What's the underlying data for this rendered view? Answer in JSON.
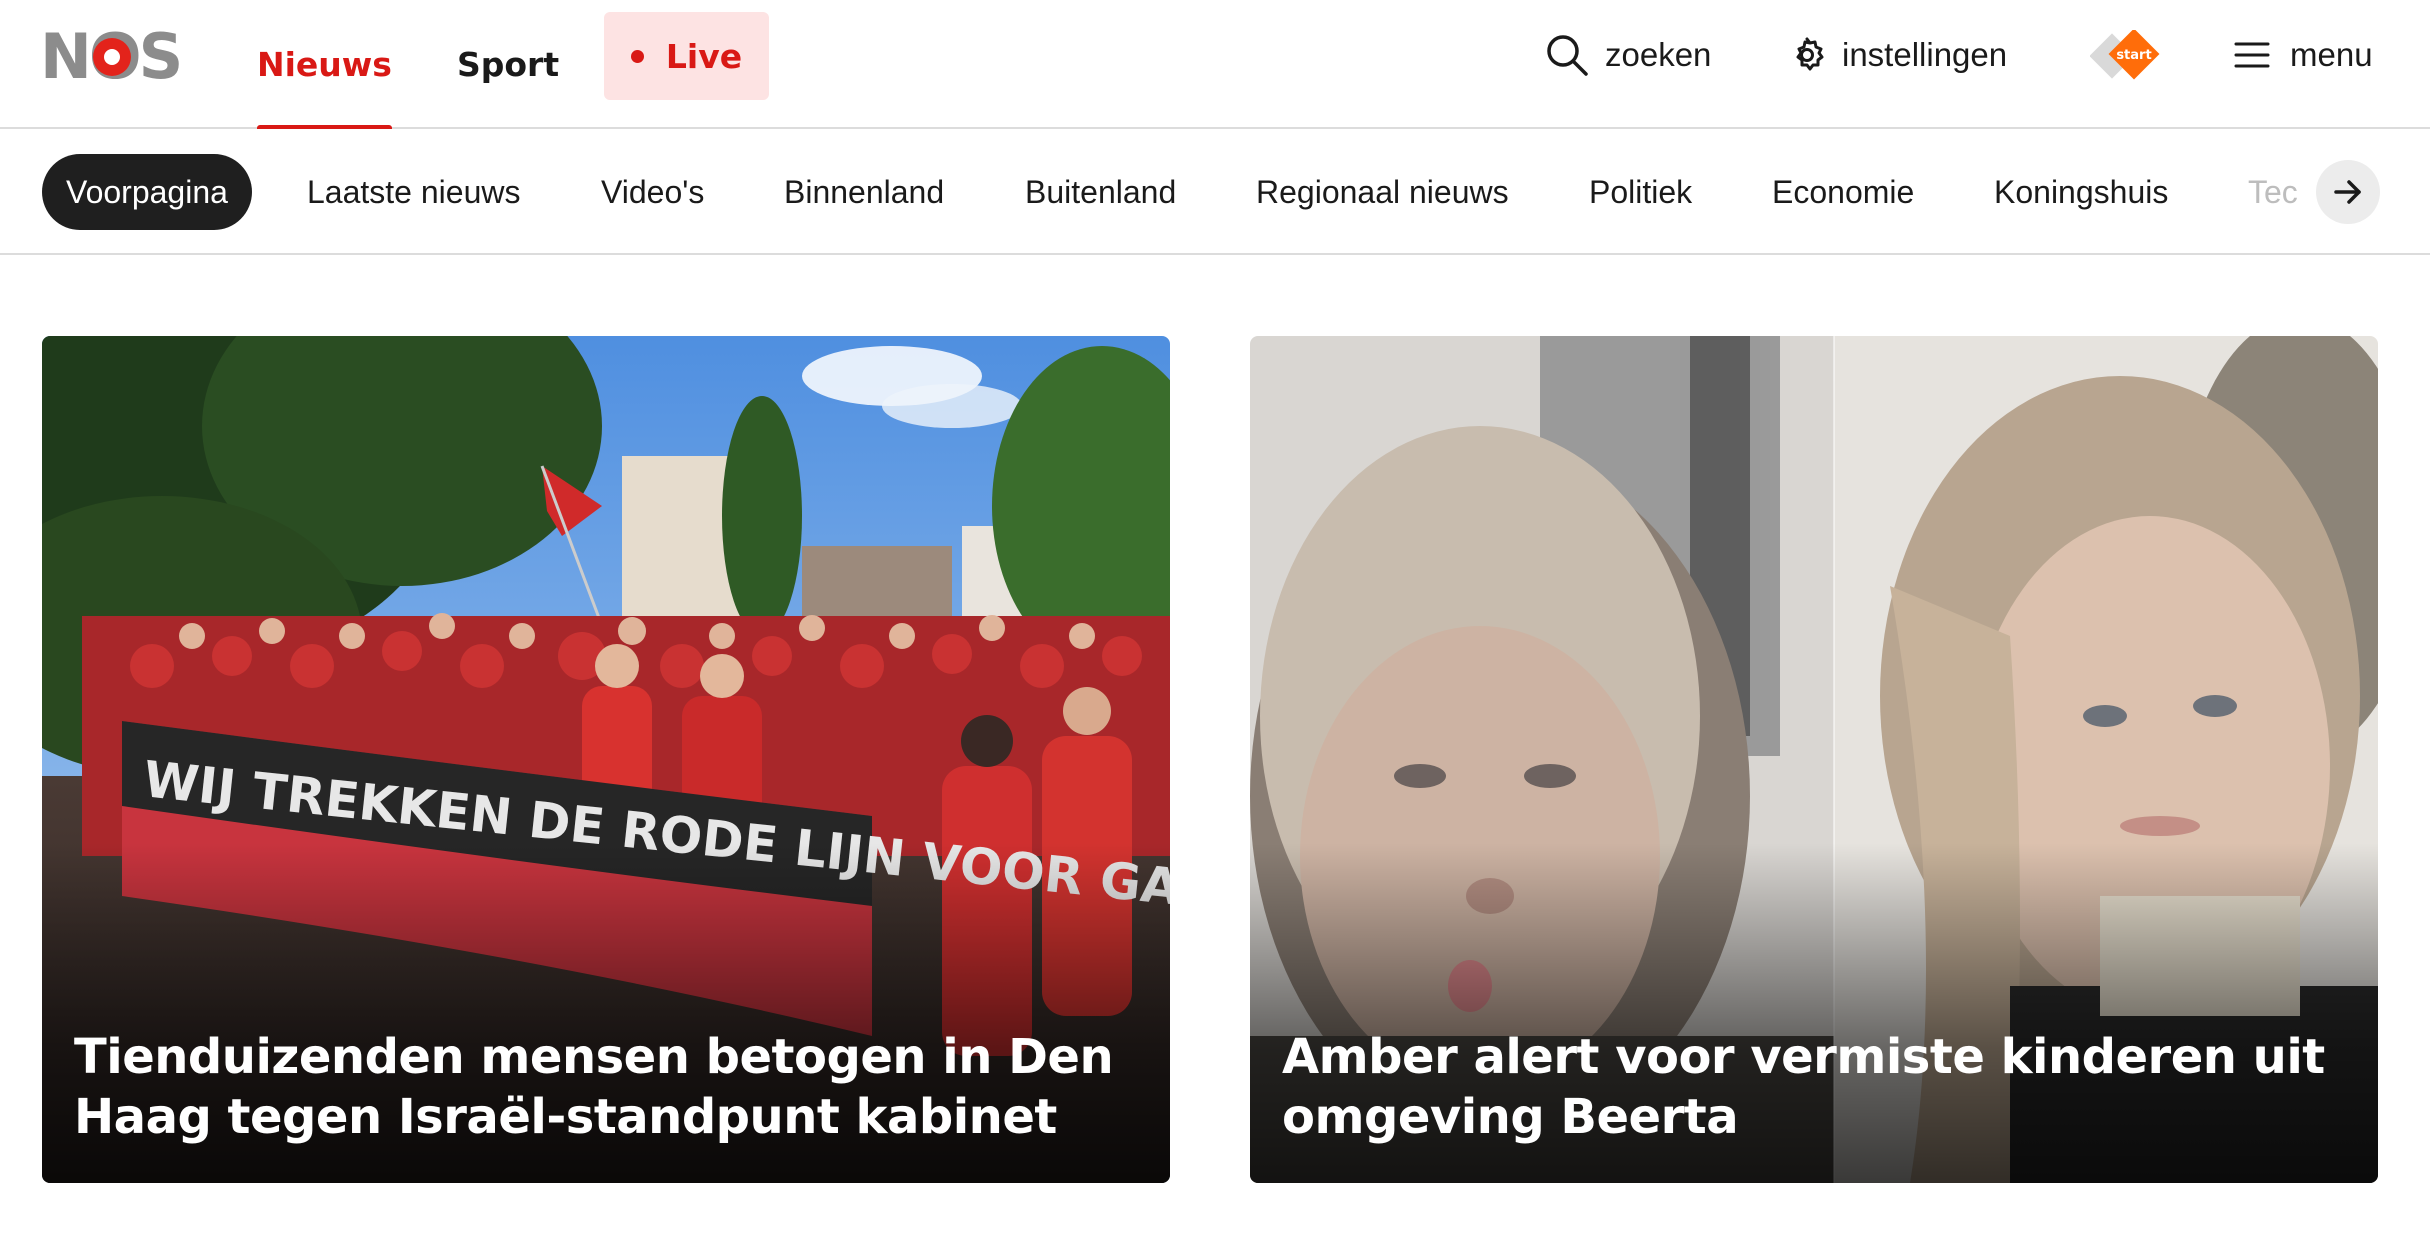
{
  "brand": {
    "logo_text": "NOS",
    "accent_color": "#d91915"
  },
  "header": {
    "nav": [
      {
        "label": "Nieuws",
        "active": true
      },
      {
        "label": "Sport",
        "active": false
      }
    ],
    "live_label": "Live",
    "search_label": "zoeken",
    "settings_label": "instellingen",
    "npo_start_badge": "start",
    "menu_label": "menu"
  },
  "categories": {
    "items": [
      {
        "label": "Voorpagina",
        "active": true
      },
      {
        "label": "Laatste nieuws"
      },
      {
        "label": "Video's"
      },
      {
        "label": "Binnenland"
      },
      {
        "label": "Buitenland"
      },
      {
        "label": "Regionaal nieuws"
      },
      {
        "label": "Politiek"
      },
      {
        "label": "Economie"
      },
      {
        "label": "Koningshuis"
      },
      {
        "label": "Tec"
      }
    ],
    "scroll_icon": "arrow-right-icon"
  },
  "stories": [
    {
      "title": "Tienduizenden mensen betogen in Den Haag tegen Israël-standpunt kabinet",
      "banner_text": "WIJ TREKKEN DE RODE LIJN VOOR GAZA"
    },
    {
      "title": "Amber alert voor vermiste kinderen uit omgeving Beerta"
    }
  ]
}
